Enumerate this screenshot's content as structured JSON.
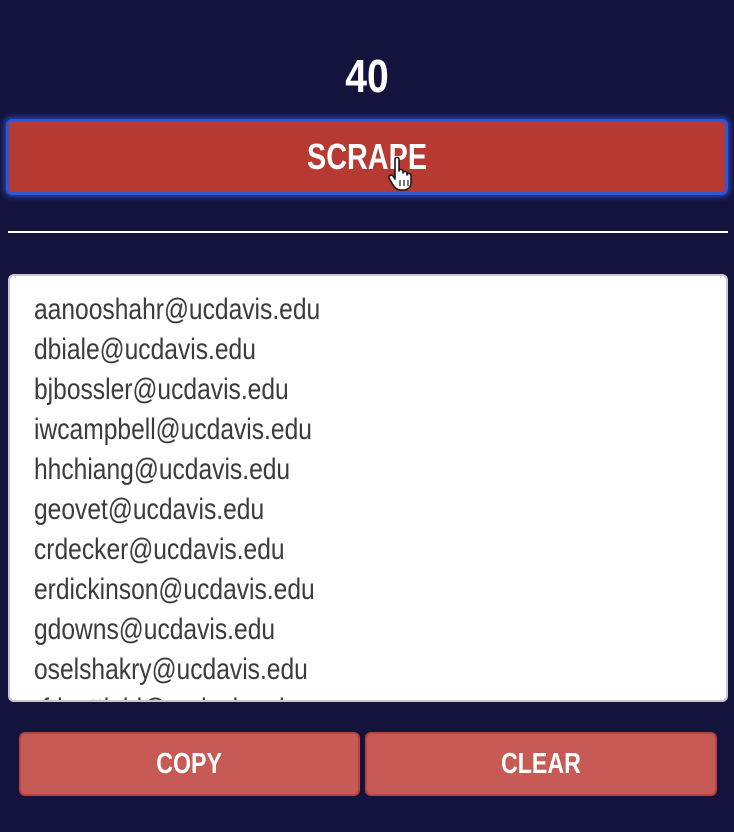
{
  "counter": {
    "value": "40"
  },
  "scrape_button": {
    "label": "SCRAPE"
  },
  "emails": [
    "aanooshahr@ucdavis.edu",
    "dbiale@ucdavis.edu",
    "bjbossler@ucdavis.edu",
    "iwcampbell@ucdavis.edu",
    "hhchiang@ucdavis.edu",
    "geovet@ucdavis.edu",
    "crdecker@ucdavis.edu",
    "erdickinson@ucdavis.edu",
    "gdowns@ucdavis.edu",
    "oselshakry@ucdavis.edu",
    "rfdanttlehl@ucdavis.edu"
  ],
  "actions": {
    "copy_label": "COPY",
    "clear_label": "CLEAR"
  },
  "icons": {
    "cursor": "hand-pointer-icon"
  },
  "colors": {
    "background": "#13133e",
    "scrape_button": "#b63a32",
    "scrape_focus_ring": "#2f56d6",
    "action_button": "#c85a55",
    "email_text": "#3b3b3b"
  }
}
